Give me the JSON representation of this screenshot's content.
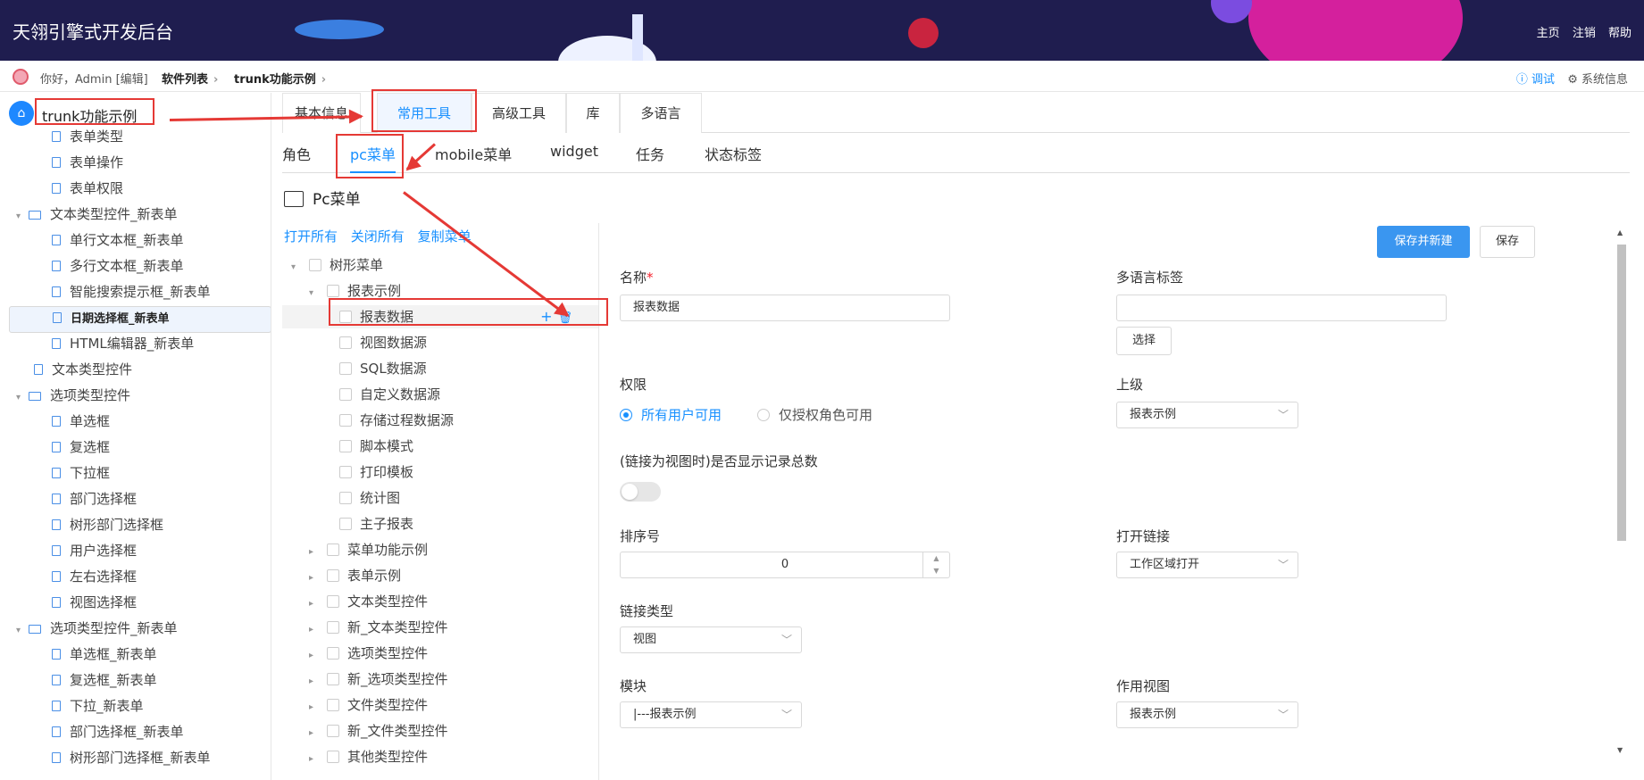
{
  "header": {
    "title": "天翎引擎式开发后台",
    "links": [
      "主页",
      "注销",
      "帮助"
    ]
  },
  "crumb": {
    "greeting": "你好，Admin [编辑]",
    "items": [
      "软件列表",
      "trunk功能示例"
    ],
    "debug": "调试",
    "sysinfo": "系统信息"
  },
  "left_tree": {
    "root": "trunk功能示例",
    "items": [
      {
        "label": "表单类型",
        "kind": "doc",
        "level": 2
      },
      {
        "label": "表单操作",
        "kind": "doc",
        "level": 2
      },
      {
        "label": "表单权限",
        "kind": "doc",
        "level": 2
      },
      {
        "label": "文本类型控件_新表单",
        "kind": "folder",
        "level": 1
      },
      {
        "label": "单行文本框_新表单",
        "kind": "doc",
        "level": 2
      },
      {
        "label": "多行文本框_新表单",
        "kind": "doc",
        "level": 2
      },
      {
        "label": "智能搜索提示框_新表单",
        "kind": "doc",
        "level": 2
      },
      {
        "label": "日期选择框_新表单",
        "kind": "doc",
        "level": 2,
        "selected": true
      },
      {
        "label": "HTML编辑器_新表单",
        "kind": "doc",
        "level": 2
      },
      {
        "label": "文本类型控件",
        "kind": "doc",
        "level": 1
      },
      {
        "label": "选项类型控件",
        "kind": "folder",
        "level": 1
      },
      {
        "label": "单选框",
        "kind": "doc",
        "level": 2
      },
      {
        "label": "复选框",
        "kind": "doc",
        "level": 2
      },
      {
        "label": "下拉框",
        "kind": "doc",
        "level": 2
      },
      {
        "label": "部门选择框",
        "kind": "doc",
        "level": 2
      },
      {
        "label": "树形部门选择框",
        "kind": "doc",
        "level": 2
      },
      {
        "label": "用户选择框",
        "kind": "doc",
        "level": 2
      },
      {
        "label": "左右选择框",
        "kind": "doc",
        "level": 2
      },
      {
        "label": "视图选择框",
        "kind": "doc",
        "level": 2
      },
      {
        "label": "选项类型控件_新表单",
        "kind": "folder",
        "level": 1
      },
      {
        "label": "单选框_新表单",
        "kind": "doc",
        "level": 2
      },
      {
        "label": "复选框_新表单",
        "kind": "doc",
        "level": 2
      },
      {
        "label": "下拉_新表单",
        "kind": "doc",
        "level": 2
      },
      {
        "label": "部门选择框_新表单",
        "kind": "doc",
        "level": 2
      },
      {
        "label": "树形部门选择框_新表单",
        "kind": "doc",
        "level": 2
      }
    ]
  },
  "tabs1": [
    {
      "label": "基本信息"
    },
    {
      "label": "常用工具",
      "active": true
    },
    {
      "label": "高级工具"
    },
    {
      "label": "库"
    },
    {
      "label": "多语言"
    }
  ],
  "tabs2": [
    {
      "label": "角色"
    },
    {
      "label": "pc菜单",
      "active": true
    },
    {
      "label": "mobile菜单"
    },
    {
      "label": "widget"
    },
    {
      "label": "任务"
    },
    {
      "label": "状态标签"
    }
  ],
  "section_title": "Pc菜单",
  "menu_tree": {
    "actions": [
      "打开所有",
      "关闭所有",
      "复制菜单"
    ],
    "rows": [
      {
        "label": "树形菜单",
        "level": 0,
        "caret": "down"
      },
      {
        "label": "报表示例",
        "level": 1,
        "caret": "down"
      },
      {
        "label": "报表数据",
        "level": 2,
        "highlight": true
      },
      {
        "label": "视图数据源",
        "level": 2
      },
      {
        "label": "SQL数据源",
        "level": 2
      },
      {
        "label": "自定义数据源",
        "level": 2
      },
      {
        "label": "存储过程数据源",
        "level": 2
      },
      {
        "label": "脚本模式",
        "level": 2
      },
      {
        "label": "打印模板",
        "level": 2
      },
      {
        "label": "统计图",
        "level": 2
      },
      {
        "label": "主子报表",
        "level": 2
      },
      {
        "label": "菜单功能示例",
        "level": 1,
        "caret": "right"
      },
      {
        "label": "表单示例",
        "level": 1,
        "caret": "right"
      },
      {
        "label": "文本类型控件",
        "level": 1,
        "caret": "right"
      },
      {
        "label": "新_文本类型控件",
        "level": 1,
        "caret": "right"
      },
      {
        "label": "选项类型控件",
        "level": 1,
        "caret": "right"
      },
      {
        "label": "新_选项类型控件",
        "level": 1,
        "caret": "right"
      },
      {
        "label": "文件类型控件",
        "level": 1,
        "caret": "right"
      },
      {
        "label": "新_文件类型控件",
        "level": 1,
        "caret": "right"
      },
      {
        "label": "其他类型控件",
        "level": 1,
        "caret": "right"
      }
    ],
    "row_icons": {
      "add": "+",
      "delete": "🗑"
    }
  },
  "form": {
    "save_new": "保存并新建",
    "save": "保存",
    "name_label": "名称",
    "name_required": "*",
    "name_value": "报表数据",
    "i18n_label": "多语言标签",
    "i18n_value": "",
    "select_button": "选择",
    "perm_label": "权限",
    "perm_options": [
      "所有用户可用",
      "仅授权角色可用"
    ],
    "parent_label": "上级",
    "parent_value": "报表示例",
    "show_count_label": "(链接为视图时)是否显示记录总数",
    "order_label": "排序号",
    "order_value": "0",
    "open_label": "打开链接",
    "open_value": "工作区域打开",
    "link_type_label": "链接类型",
    "link_type_value": "视图",
    "module_label": "模块",
    "module_value": "|---报表示例",
    "view_label": "作用视图",
    "view_value": "报表示例"
  },
  "colors": {
    "header_bg": "#1f1d4f",
    "accent": "#1890ff",
    "annotation": "#e53935"
  }
}
